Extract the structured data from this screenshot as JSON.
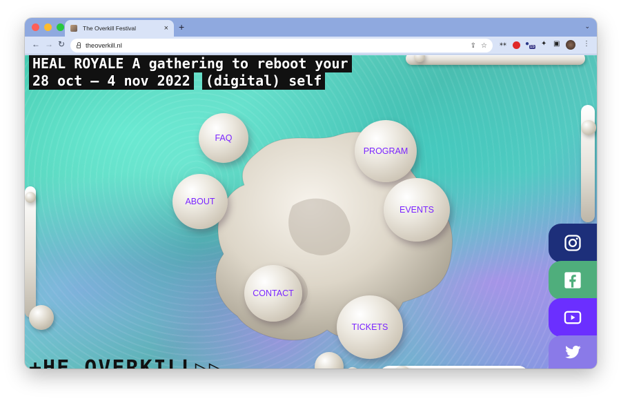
{
  "browser": {
    "tab_title": "The Overkill Festival",
    "tab_close": "×",
    "new_tab": "+",
    "tab_menu": "⌄",
    "url": "theoverkill.nl",
    "ext_badge": "15"
  },
  "page": {
    "headline_line1": "HEAL ROYALE A gathering to reboot your",
    "headline_dates": "28 oct — 4 nov 2022",
    "headline_end": "(digital) self",
    "logo_text": "+HE OVERKILL▷▷",
    "menu": {
      "faq": "FAQ",
      "program": "PROGRAM",
      "about": "ABOUT",
      "events": "EVENTS",
      "contact": "CONTACT",
      "tickets": "TICKETS"
    }
  },
  "colors": {
    "menu_text": "#7a24ff",
    "instagram_bg": "#1d2f7a",
    "facebook_bg": "#4fae7c",
    "youtube_bg": "#6b2fff",
    "twitter_bg": "#8a7ae8"
  },
  "icons": [
    "instagram-icon",
    "facebook-icon",
    "youtube-icon",
    "twitter-icon"
  ]
}
